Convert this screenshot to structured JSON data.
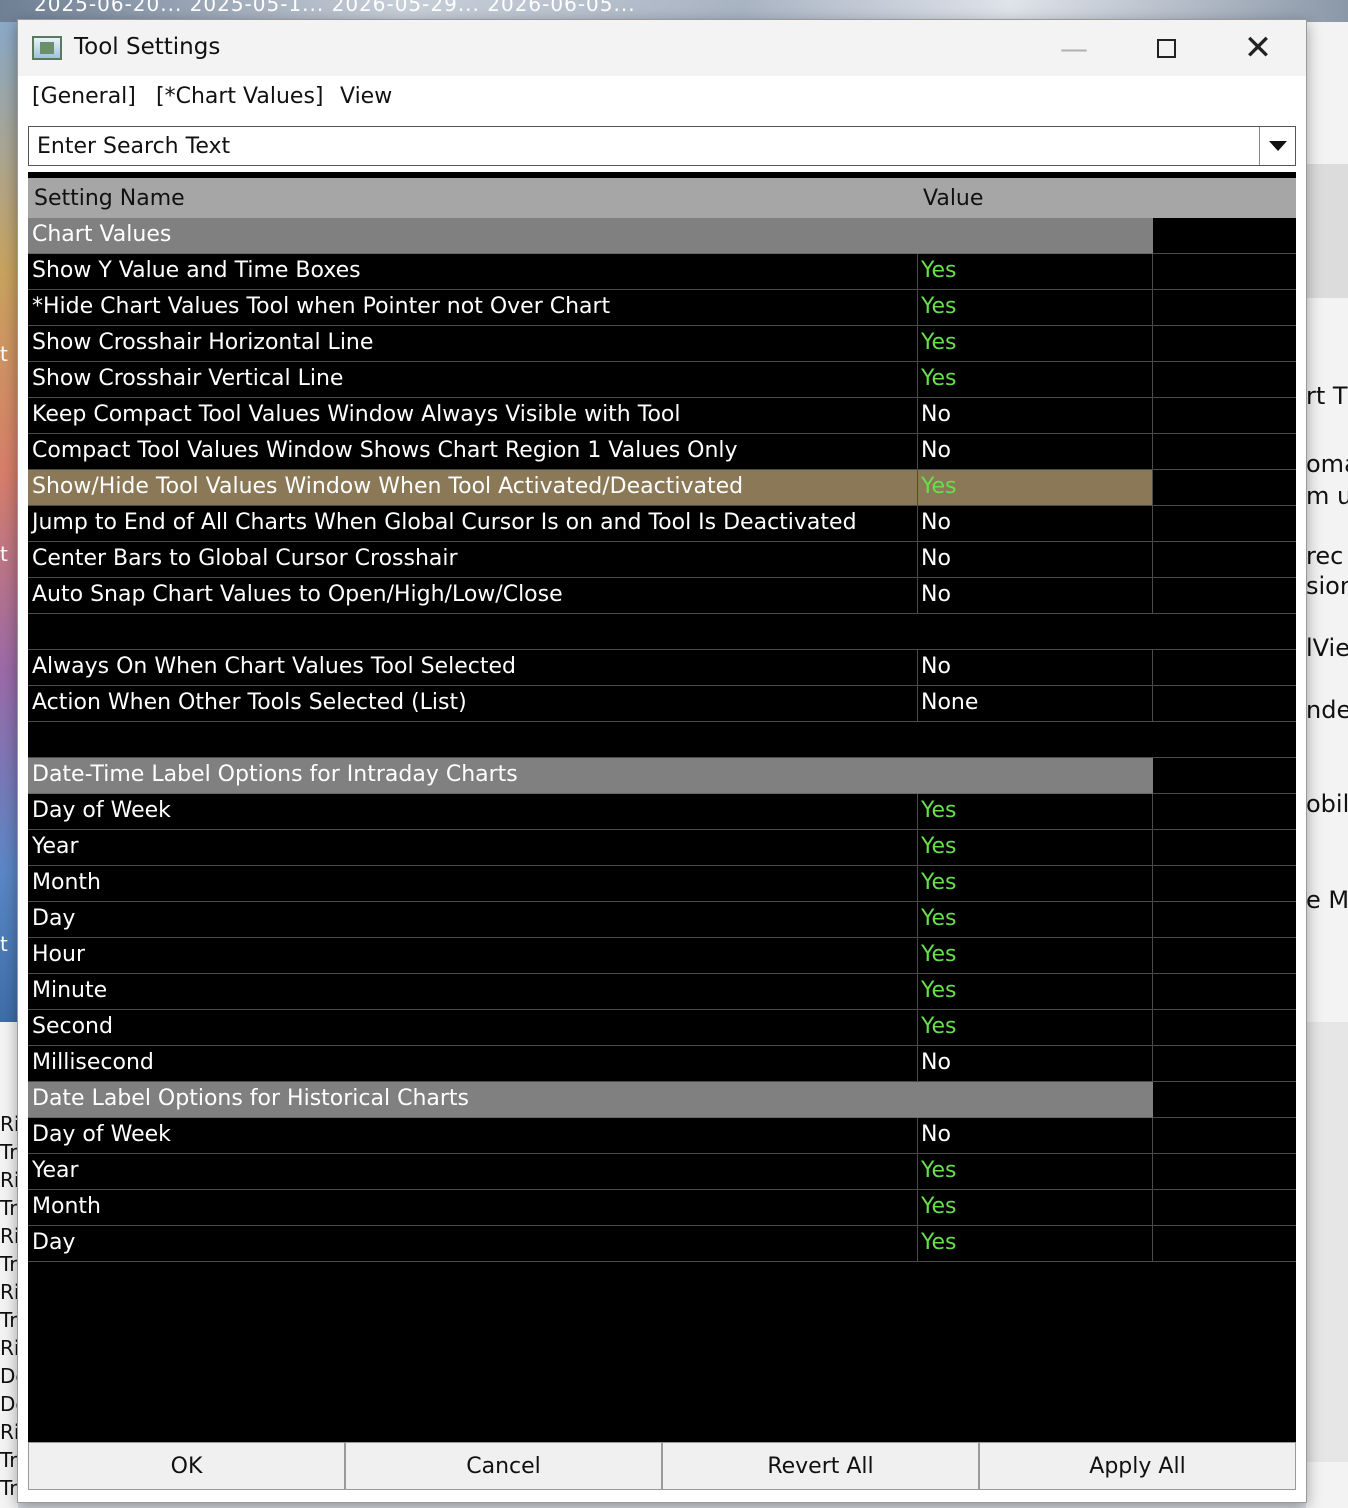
{
  "background": {
    "top_strip_text": "2025-06-20...   2025-05-1...   2026-05-29...   2026-06-05...",
    "right_fragments": [
      "rt Ti",
      "oma",
      "m u",
      "rec",
      "sion",
      "lVie",
      "nde",
      "obile",
      "e M"
    ],
    "left_fragments": [
      "Rit",
      "Tra",
      "Rit",
      "Tra",
      "Rit",
      "Tra",
      "Rit",
      "Tra",
      "Rit",
      "De",
      "De",
      "Rit",
      "Tra",
      "Tra"
    ]
  },
  "window": {
    "title": "Tool Settings",
    "controls": {
      "minimize": "—",
      "close": "✕"
    }
  },
  "menu": {
    "items": [
      "[General]",
      "[*Chart Values]",
      "View"
    ]
  },
  "search": {
    "placeholder": "Enter Search Text"
  },
  "table": {
    "headers": {
      "name": "Setting Name",
      "value": "Value"
    },
    "rows": [
      {
        "type": "section",
        "name": "Chart Values"
      },
      {
        "type": "item",
        "name": "Show Y Value and Time Boxes",
        "value": "Yes"
      },
      {
        "type": "item",
        "name": "*Hide Chart Values Tool when Pointer not Over Chart",
        "value": "Yes"
      },
      {
        "type": "item",
        "name": "Show Crosshair Horizontal Line",
        "value": "Yes"
      },
      {
        "type": "item",
        "name": "Show Crosshair Vertical Line",
        "value": "Yes"
      },
      {
        "type": "item",
        "name": "Keep Compact Tool Values Window Always Visible with Tool",
        "value": "No"
      },
      {
        "type": "item",
        "name": "Compact Tool Values Window Shows Chart Region 1 Values Only",
        "value": "No"
      },
      {
        "type": "item",
        "name": "Show/Hide Tool Values Window When Tool Activated/Deactivated",
        "value": "Yes",
        "selected": true
      },
      {
        "type": "item",
        "name": "Jump to End of All Charts When Global Cursor Is on and Tool Is Deactivated",
        "value": "No"
      },
      {
        "type": "item",
        "name": "Center Bars to Global Cursor Crosshair",
        "value": "No"
      },
      {
        "type": "item",
        "name": "Auto Snap Chart Values to Open/High/Low/Close",
        "value": "No"
      },
      {
        "type": "blank",
        "name": "",
        "value": ""
      },
      {
        "type": "item",
        "name": "Always On When Chart Values Tool Selected",
        "value": "No"
      },
      {
        "type": "item",
        "name": "Action When Other Tools Selected (List)",
        "value": "None"
      },
      {
        "type": "blank",
        "name": "",
        "value": ""
      },
      {
        "type": "section",
        "name": "Date-Time Label Options for Intraday Charts"
      },
      {
        "type": "item",
        "name": "Day of Week",
        "value": "Yes"
      },
      {
        "type": "item",
        "name": "Year",
        "value": "Yes"
      },
      {
        "type": "item",
        "name": "Month",
        "value": "Yes"
      },
      {
        "type": "item",
        "name": "Day",
        "value": "Yes"
      },
      {
        "type": "item",
        "name": "Hour",
        "value": "Yes"
      },
      {
        "type": "item",
        "name": "Minute",
        "value": "Yes"
      },
      {
        "type": "item",
        "name": "Second",
        "value": "Yes"
      },
      {
        "type": "item",
        "name": "Millisecond",
        "value": "No"
      },
      {
        "type": "section",
        "name": "Date Label Options for Historical Charts"
      },
      {
        "type": "item",
        "name": "Day of Week",
        "value": "No"
      },
      {
        "type": "item",
        "name": "Year",
        "value": "Yes"
      },
      {
        "type": "item",
        "name": "Month",
        "value": "Yes"
      },
      {
        "type": "item",
        "name": "Day",
        "value": "Yes"
      }
    ]
  },
  "footer": {
    "ok": "OK",
    "cancel": "Cancel",
    "revert_all": "Revert All",
    "apply_all": "Apply All"
  },
  "colors": {
    "yes_value": "#66e04a",
    "section_bg": "#808080",
    "selected_row_bg": "#8a7856",
    "grid_bg": "#000000",
    "header_bg": "#a6a6a6"
  }
}
